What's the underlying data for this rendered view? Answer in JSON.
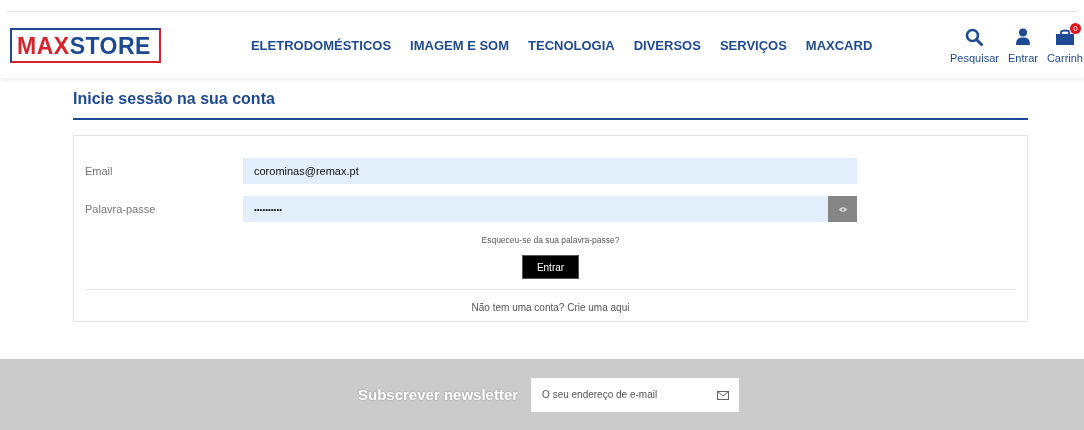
{
  "logo": {
    "part_1": "MAX",
    "part_2": "STORE"
  },
  "nav": [
    "ELETRODOMÉSTICOS",
    "IMAGEM E SOM",
    "TECNOLOGIA",
    "DIVERSOS",
    "SERVIÇOS",
    "MAXCARD"
  ],
  "actions": [
    {
      "kind": "search",
      "label": "Pesquisar"
    },
    {
      "kind": "user",
      "label": "Entrar"
    },
    {
      "kind": "cart",
      "label": "Carrinh",
      "badge": "0"
    }
  ],
  "page_title": "Inicie sessão na sua conta",
  "form": {
    "fields": [
      {
        "label": "Email",
        "value": "corominas@remax.pt",
        "kind": "text"
      },
      {
        "label": "Palavra-passe",
        "value": "••••••••••",
        "kind": "password"
      }
    ],
    "forgot": "Esqueceu-se da sua palavra-passe?",
    "submit": "Entrar",
    "signup": "Não tem uma conta? Crie uma aqui"
  },
  "newsletter": {
    "title": "Subscrever newsletter",
    "placeholder": "O seu endereço de e-mail"
  }
}
